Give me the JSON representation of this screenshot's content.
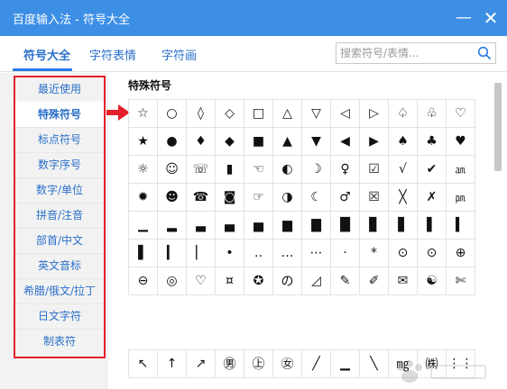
{
  "window": {
    "title": "百度输入法 - 符号大全",
    "minimize_label": "—",
    "close_label": "✕",
    "colors": {
      "titlebar": "#3d8fe6",
      "accent": "#2b78e4",
      "highlight_box": "#e6202a"
    }
  },
  "tabs": [
    {
      "label": "符号大全",
      "active": true
    },
    {
      "label": "字符表情",
      "active": false
    },
    {
      "label": "字符画",
      "active": false
    }
  ],
  "search": {
    "placeholder": "搜索符号/表情..."
  },
  "sidebar": {
    "items": [
      {
        "label": "最近使用"
      },
      {
        "label": "特殊符号",
        "active": true
      },
      {
        "label": "标点符号"
      },
      {
        "label": "数字序号"
      },
      {
        "label": "数字/单位"
      },
      {
        "label": "拼音/注音"
      },
      {
        "label": "部首/中文"
      },
      {
        "label": "英文音标"
      },
      {
        "label": "希腊/俄文/拉丁"
      },
      {
        "label": "日文字符"
      },
      {
        "label": "制表符"
      }
    ]
  },
  "section_title": "特殊符号",
  "symbols": [
    [
      "☆",
      "○",
      "◊",
      "◇",
      "□",
      "△",
      "▽",
      "◁",
      "▷",
      "♤",
      "♧",
      "♡"
    ],
    [
      "★",
      "●",
      "♦",
      "◆",
      "■",
      "▲",
      "▼",
      "◀",
      "▶",
      "♠",
      "♣",
      "♥"
    ],
    [
      "☼",
      "☺",
      "☏",
      "▮",
      "☜",
      "◐",
      "☽",
      "♀",
      "☑",
      "√",
      "✔",
      "㏂"
    ],
    [
      "✹",
      "☻",
      "☎",
      "◙",
      "☞",
      "◑",
      "☾",
      "♂",
      "☒",
      "╳",
      "✗",
      "㏘"
    ],
    [
      "▁",
      "▂",
      "▃",
      "▄",
      "▅",
      "▆",
      "▇",
      "█",
      "▊",
      "▋",
      "▌",
      "▍"
    ],
    [
      "▌",
      "▎",
      "▏",
      "•",
      "‥",
      "…",
      "⋯",
      "·",
      "*",
      "⊙",
      "⊙",
      "⊕"
    ],
    [
      "⊖",
      "◎",
      "♡",
      "¤",
      "✪",
      "の",
      "◿",
      "✎",
      "✐",
      "✉",
      "☯",
      "✄"
    ]
  ],
  "symbols_row2": [
    "↖",
    "↑",
    "↗",
    "㊚",
    "㊤",
    "㊛",
    "╱",
    "▁",
    "╲",
    "㎎",
    "㈱",
    "⋮⋮"
  ]
}
